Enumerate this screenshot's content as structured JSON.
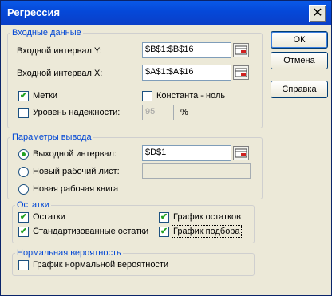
{
  "title": "Регрессия",
  "close_glyph": "✕",
  "buttons": {
    "ok": "ОК",
    "cancel": "Отмена",
    "help": "Справка"
  },
  "input_group": {
    "legend": "Входные данные",
    "y_label": "Входной интервал Y:",
    "y_value": "$B$1:$B$16",
    "x_label": "Входной интервал X:",
    "x_value": "$A$1:$A$16",
    "labels_cb": {
      "label": "Метки",
      "checked": true
    },
    "const_cb": {
      "label": "Константа - ноль",
      "checked": false
    },
    "conf_cb": {
      "label": "Уровень надежности:",
      "checked": false
    },
    "conf_value": "95",
    "conf_unit": "%"
  },
  "output_group": {
    "legend": "Параметры вывода",
    "radio_output": {
      "label": "Выходной интервал:",
      "selected": true
    },
    "output_value": "$D$1",
    "radio_new_sheet": {
      "label": "Новый рабочий лист:",
      "selected": false
    },
    "radio_new_book": {
      "label": "Новая рабочая книга",
      "selected": false
    }
  },
  "residuals_group": {
    "legend": "Остатки",
    "residuals": {
      "label": "Остатки",
      "checked": true
    },
    "std_residuals": {
      "label": "Стандартизованные остатки",
      "checked": true
    },
    "residual_plot": {
      "label": "График остатков",
      "checked": true
    },
    "fit_plot": {
      "label": "График подбора",
      "checked": true
    }
  },
  "normal_group": {
    "legend": "Нормальная вероятность",
    "normal_plot": {
      "label": "График нормальной вероятности",
      "checked": false
    }
  },
  "check_glyph": "✔"
}
